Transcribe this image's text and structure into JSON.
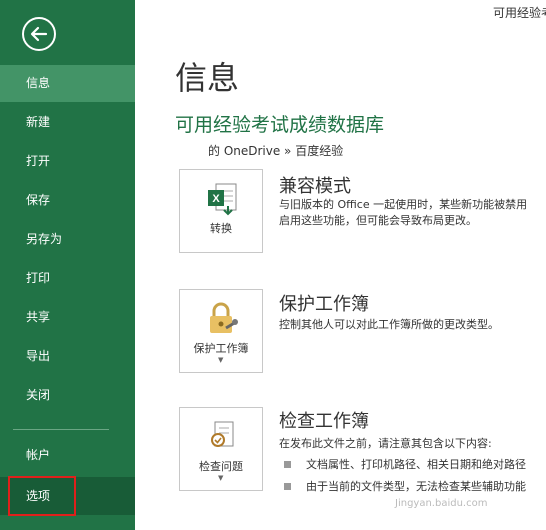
{
  "window": {
    "title_fragment": "可用经验考"
  },
  "sidebar": {
    "items": [
      {
        "label": "信息"
      },
      {
        "label": "新建"
      },
      {
        "label": "打开"
      },
      {
        "label": "保存"
      },
      {
        "label": "另存为"
      },
      {
        "label": "打印"
      },
      {
        "label": "共享"
      },
      {
        "label": "导出"
      },
      {
        "label": "关闭"
      },
      {
        "label": "帐户"
      },
      {
        "label": "选项"
      }
    ]
  },
  "main": {
    "page_title": "信息",
    "doc_title": "可用经验考试成绩数据库",
    "doc_path": "的 OneDrive » 百度经验",
    "sections": [
      {
        "button_label": "转换",
        "title": "兼容模式",
        "lines": [
          "与旧版本的 Office 一起使用时，某些新功能被禁用",
          "启用这些功能，但可能会导致布局更改。"
        ]
      },
      {
        "button_label": "保护工作簿",
        "title": "保护工作簿",
        "lines": [
          "控制其他人可以对此工作簿所做的更改类型。"
        ]
      },
      {
        "button_label": "检查问题",
        "title": "检查工作簿",
        "lines": [
          "在发布此文件之前，请注意其包含以下内容:"
        ],
        "bullets": [
          "文档属性、打印机路径、相关日期和绝对路径",
          "由于当前的文件类型，无法检查某些辅助功能"
        ]
      }
    ]
  },
  "watermark": "Jingyan.baidu.com",
  "colors": {
    "sidebar": "#217346",
    "active": "#439467",
    "highlight": "#e0201b"
  }
}
